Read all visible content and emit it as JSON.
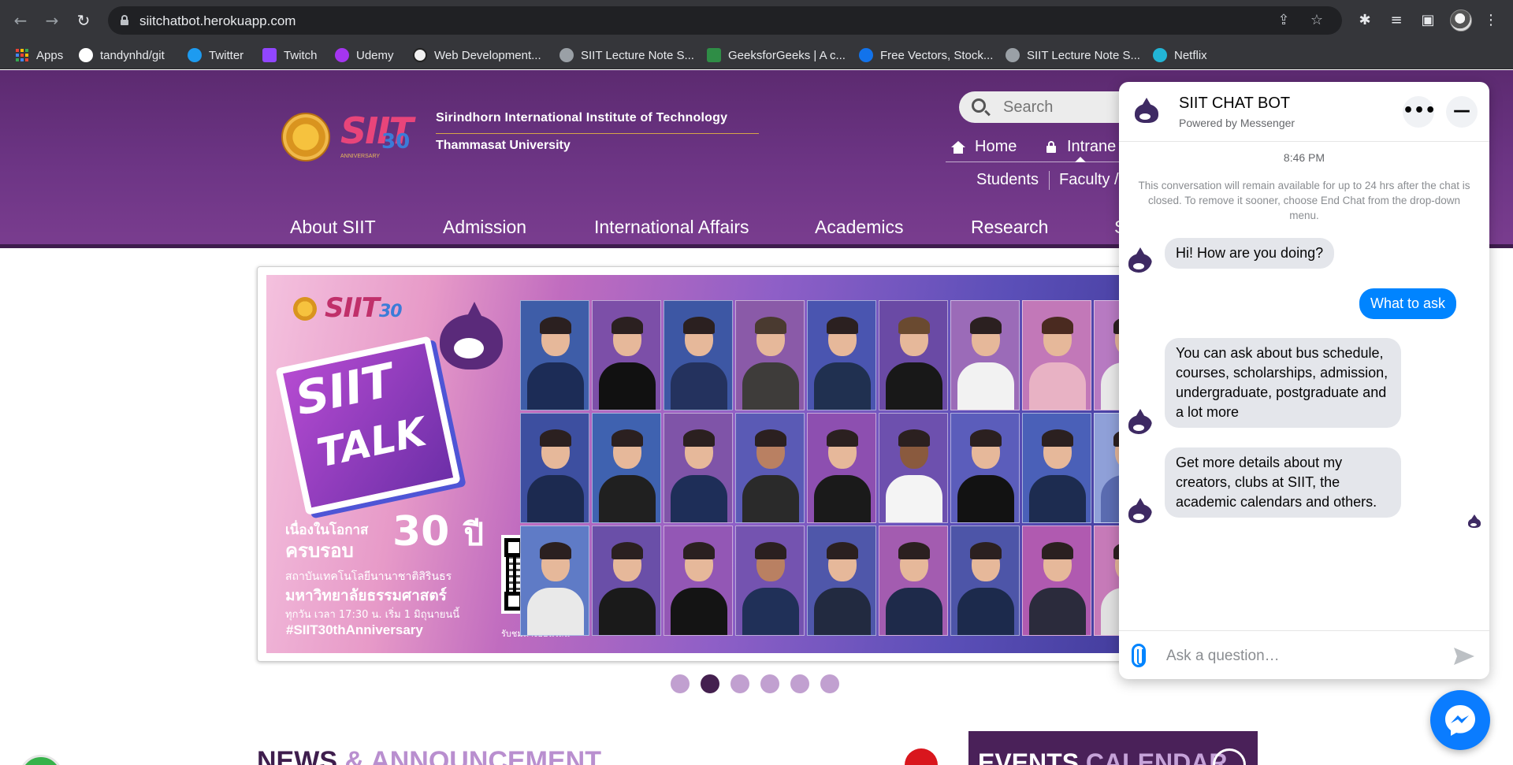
{
  "browser": {
    "url": "siitchatbot.herokuapp.com",
    "bookmarks": [
      {
        "label": "Apps",
        "icon": "apps-grid-icon"
      },
      {
        "label": "tandynhd/git",
        "icon": "github-icon"
      },
      {
        "label": "Twitter",
        "icon": "twitter-icon"
      },
      {
        "label": "Twitch",
        "icon": "twitch-icon"
      },
      {
        "label": "Udemy",
        "icon": "udemy-icon"
      },
      {
        "label": "Web Development...",
        "icon": "web-dev-icon"
      },
      {
        "label": "SIIT Lecture Note S...",
        "icon": "globe-icon"
      },
      {
        "label": "GeeksforGeeks | A c...",
        "icon": "geeksforgeeks-icon"
      },
      {
        "label": "Free Vectors, Stock...",
        "icon": "freepik-icon"
      },
      {
        "label": "SIIT Lecture Note S...",
        "icon": "globe-icon"
      },
      {
        "label": "Netflix",
        "icon": "netflix-icon"
      }
    ]
  },
  "site": {
    "institute": "Sirindhorn International Institute of Technology",
    "university": "Thammasat University",
    "logo_text": "SIIT",
    "logo_anniversary": "30",
    "logo_anniversary_label": "ANNIVERSARY",
    "search_placeholder": "Search",
    "top_links": {
      "home": "Home",
      "intranet": "Intrane",
      "students": "Students",
      "faculty": "Faculty /"
    },
    "main_nav": [
      "About SIIT",
      "Admission",
      "International Affairs",
      "Academics",
      "Research",
      "S"
    ],
    "banner": {
      "logo_text": "SIIT",
      "logo_anniversary": "30",
      "talk_line1": "SIIT",
      "talk_line2": "TALK",
      "big_number": "30",
      "big_number_suffix": "ปี",
      "thai_line1": "เนื่องในโอกาส",
      "thai_line2": "ครบรอบ",
      "thai_line3": "สถาบันเทคโนโลยีนานาชาติสิรินธร",
      "thai_line4": "มหาวิทยาลัยธรรมศาสตร์",
      "thai_line5": "ทุกวัน เวลา 17:30 น. เริ่ม 1 มิถุนายนนี้",
      "hashtag": "#SIIT30thAnniversary",
      "qr_caption": "รับชมทางออนไลน์"
    },
    "carousel": {
      "total": 6,
      "active": 2
    },
    "news_title": "NEWS",
    "news_title_suffix": "& ANNOUNCEMENT",
    "events_title": "EVENTS",
    "events_title_suffix": "CALENDAR"
  },
  "chat": {
    "title": "SIIT CHAT BOT",
    "subtitle": "Powered by Messenger",
    "time": "8:46 PM",
    "notice": "This conversation will remain available for up to 24 hrs after the chat is closed. To remove it sooner, choose End Chat from the drop-down menu.",
    "messages": [
      {
        "from": "bot",
        "text": "Hi! How are you doing?"
      },
      {
        "from": "user",
        "text": "What to ask"
      },
      {
        "from": "bot",
        "text": "You can ask about bus schedule, courses, scholarships, admission, undergraduate, postgraduate and a lot more"
      },
      {
        "from": "bot",
        "text": "Get more details about my creators, clubs at SIIT, the academic calendars and others."
      }
    ],
    "input_placeholder": "Ask a question…",
    "more_button": "•••",
    "minimize_button": "—"
  },
  "colors": {
    "site_purple": "#6d3585",
    "messenger_blue": "#0084ff",
    "bubble_gray": "#e4e6eb"
  }
}
